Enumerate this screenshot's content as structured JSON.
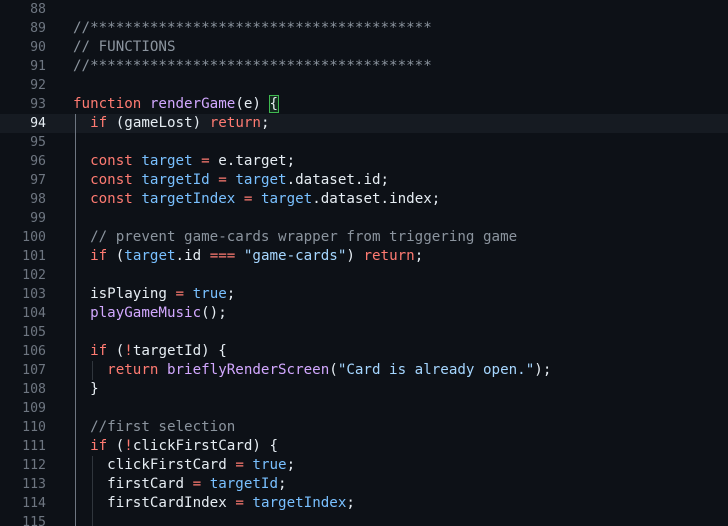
{
  "editor": {
    "lines": [
      {
        "num": "88",
        "tokens": []
      },
      {
        "num": "89",
        "tokens": [
          {
            "t": "//****************************************",
            "c": "cmt"
          }
        ]
      },
      {
        "num": "90",
        "tokens": [
          {
            "t": "// FUNCTIONS",
            "c": "cmt"
          }
        ]
      },
      {
        "num": "91",
        "tokens": [
          {
            "t": "//****************************************",
            "c": "cmt"
          }
        ]
      },
      {
        "num": "92",
        "tokens": []
      },
      {
        "num": "93",
        "tokens": [
          {
            "t": "function",
            "c": "kw"
          },
          {
            "t": " ",
            "c": "var"
          },
          {
            "t": "renderGame",
            "c": "fn"
          },
          {
            "t": "(",
            "c": "paren"
          },
          {
            "t": "e",
            "c": "var"
          },
          {
            "t": ")",
            "c": "paren"
          },
          {
            "t": " ",
            "c": "var"
          },
          {
            "t": "{",
            "c": "brace-match"
          }
        ]
      },
      {
        "num": "94",
        "current": true,
        "tokens": [
          {
            "t": "  ",
            "c": "var"
          },
          {
            "t": "if",
            "c": "kw"
          },
          {
            "t": " (",
            "c": "paren"
          },
          {
            "t": "gameLost",
            "c": "var"
          },
          {
            "t": ") ",
            "c": "paren"
          },
          {
            "t": "return",
            "c": "kw"
          },
          {
            "t": ";",
            "c": "punct"
          }
        ]
      },
      {
        "num": "95",
        "tokens": []
      },
      {
        "num": "96",
        "tokens": [
          {
            "t": "  ",
            "c": "var"
          },
          {
            "t": "const",
            "c": "kw"
          },
          {
            "t": " ",
            "c": "var"
          },
          {
            "t": "target",
            "c": "const"
          },
          {
            "t": " ",
            "c": "var"
          },
          {
            "t": "=",
            "c": "op"
          },
          {
            "t": " e.target;",
            "c": "var"
          }
        ]
      },
      {
        "num": "97",
        "tokens": [
          {
            "t": "  ",
            "c": "var"
          },
          {
            "t": "const",
            "c": "kw"
          },
          {
            "t": " ",
            "c": "var"
          },
          {
            "t": "targetId",
            "c": "const"
          },
          {
            "t": " ",
            "c": "var"
          },
          {
            "t": "=",
            "c": "op"
          },
          {
            "t": " ",
            "c": "var"
          },
          {
            "t": "target",
            "c": "const"
          },
          {
            "t": ".dataset.id;",
            "c": "var"
          }
        ]
      },
      {
        "num": "98",
        "tokens": [
          {
            "t": "  ",
            "c": "var"
          },
          {
            "t": "const",
            "c": "kw"
          },
          {
            "t": " ",
            "c": "var"
          },
          {
            "t": "targetIndex",
            "c": "const"
          },
          {
            "t": " ",
            "c": "var"
          },
          {
            "t": "=",
            "c": "op"
          },
          {
            "t": " ",
            "c": "var"
          },
          {
            "t": "target",
            "c": "const"
          },
          {
            "t": ".dataset.index;",
            "c": "var"
          }
        ]
      },
      {
        "num": "99",
        "tokens": []
      },
      {
        "num": "100",
        "tokens": [
          {
            "t": "  ",
            "c": "var"
          },
          {
            "t": "// prevent game-cards wrapper from triggering game",
            "c": "cmt"
          }
        ]
      },
      {
        "num": "101",
        "tokens": [
          {
            "t": "  ",
            "c": "var"
          },
          {
            "t": "if",
            "c": "kw"
          },
          {
            "t": " (",
            "c": "paren"
          },
          {
            "t": "target",
            "c": "const"
          },
          {
            "t": ".id ",
            "c": "var"
          },
          {
            "t": "===",
            "c": "op"
          },
          {
            "t": " ",
            "c": "var"
          },
          {
            "t": "\"game-cards\"",
            "c": "str"
          },
          {
            "t": ") ",
            "c": "paren"
          },
          {
            "t": "return",
            "c": "kw"
          },
          {
            "t": ";",
            "c": "punct"
          }
        ]
      },
      {
        "num": "102",
        "tokens": []
      },
      {
        "num": "103",
        "tokens": [
          {
            "t": "  ",
            "c": "var"
          },
          {
            "t": "isPlaying",
            "c": "var"
          },
          {
            "t": " ",
            "c": "var"
          },
          {
            "t": "=",
            "c": "op"
          },
          {
            "t": " ",
            "c": "var"
          },
          {
            "t": "true",
            "c": "bool"
          },
          {
            "t": ";",
            "c": "punct"
          }
        ]
      },
      {
        "num": "104",
        "tokens": [
          {
            "t": "  ",
            "c": "var"
          },
          {
            "t": "playGameMusic",
            "c": "fn"
          },
          {
            "t": "();",
            "c": "punct"
          }
        ]
      },
      {
        "num": "105",
        "tokens": []
      },
      {
        "num": "106",
        "tokens": [
          {
            "t": "  ",
            "c": "var"
          },
          {
            "t": "if",
            "c": "kw"
          },
          {
            "t": " (",
            "c": "paren"
          },
          {
            "t": "!",
            "c": "op"
          },
          {
            "t": "targetId",
            "c": "var"
          },
          {
            "t": ") {",
            "c": "paren"
          }
        ]
      },
      {
        "num": "107",
        "tokens": [
          {
            "t": "    ",
            "c": "var"
          },
          {
            "t": "return",
            "c": "kw"
          },
          {
            "t": " ",
            "c": "var"
          },
          {
            "t": "brieflyRenderScreen",
            "c": "fn"
          },
          {
            "t": "(",
            "c": "paren"
          },
          {
            "t": "\"Card is already open.\"",
            "c": "str"
          },
          {
            "t": ");",
            "c": "punct"
          }
        ]
      },
      {
        "num": "108",
        "tokens": [
          {
            "t": "  ",
            "c": "var"
          },
          {
            "t": "}",
            "c": "punct"
          }
        ]
      },
      {
        "num": "109",
        "tokens": []
      },
      {
        "num": "110",
        "tokens": [
          {
            "t": "  ",
            "c": "var"
          },
          {
            "t": "//first selection",
            "c": "cmt"
          }
        ]
      },
      {
        "num": "111",
        "tokens": [
          {
            "t": "  ",
            "c": "var"
          },
          {
            "t": "if",
            "c": "kw"
          },
          {
            "t": " (",
            "c": "paren"
          },
          {
            "t": "!",
            "c": "op"
          },
          {
            "t": "clickFirstCard",
            "c": "var"
          },
          {
            "t": ") {",
            "c": "paren"
          }
        ]
      },
      {
        "num": "112",
        "tokens": [
          {
            "t": "    ",
            "c": "var"
          },
          {
            "t": "clickFirstCard",
            "c": "var"
          },
          {
            "t": " ",
            "c": "var"
          },
          {
            "t": "=",
            "c": "op"
          },
          {
            "t": " ",
            "c": "var"
          },
          {
            "t": "true",
            "c": "bool"
          },
          {
            "t": ";",
            "c": "punct"
          }
        ]
      },
      {
        "num": "113",
        "tokens": [
          {
            "t": "    ",
            "c": "var"
          },
          {
            "t": "firstCard",
            "c": "var"
          },
          {
            "t": " ",
            "c": "var"
          },
          {
            "t": "=",
            "c": "op"
          },
          {
            "t": " ",
            "c": "var"
          },
          {
            "t": "targetId",
            "c": "const"
          },
          {
            "t": ";",
            "c": "punct"
          }
        ]
      },
      {
        "num": "114",
        "tokens": [
          {
            "t": "    ",
            "c": "var"
          },
          {
            "t": "firstCardIndex",
            "c": "var"
          },
          {
            "t": " ",
            "c": "var"
          },
          {
            "t": "=",
            "c": "op"
          },
          {
            "t": " ",
            "c": "var"
          },
          {
            "t": "targetIndex",
            "c": "const"
          },
          {
            "t": ";",
            "c": "punct"
          }
        ]
      },
      {
        "num": "115",
        "tokens": []
      }
    ]
  }
}
